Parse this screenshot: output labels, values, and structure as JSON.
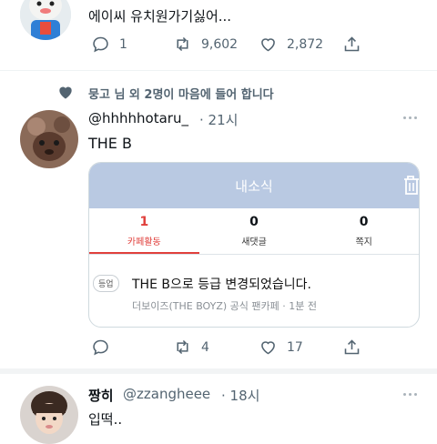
{
  "tweet1": {
    "text": "에이씨 유치원가기싫어...",
    "actions": {
      "replies": "1",
      "retweets": "9,602",
      "likes": "2,872"
    }
  },
  "social_context": "뭉고 님 외 2명이 마음에 들어 합니다",
  "tweet2": {
    "handle": "@hhhhhotaru_",
    "time": "· 21시",
    "text": "THE B",
    "card": {
      "header": "내소식",
      "stats": [
        {
          "num": "1",
          "label": "카페활동"
        },
        {
          "num": "0",
          "label": "새댓글"
        },
        {
          "num": "0",
          "label": "쪽지"
        }
      ],
      "badge": "등업",
      "message": "THE B으로 등급 변경되었습니다.",
      "source": "더보이즈(THE BOYZ) 공식 팬카페 · 1분 전"
    },
    "actions": {
      "retweets": "4",
      "likes": "17"
    }
  },
  "tweet3": {
    "name": "짱히",
    "handle": "@zzangheee",
    "time": "· 18시",
    "text": "입떡.."
  },
  "colors": {
    "accent": "#e0403c",
    "card_header": "#b9c9e2",
    "muted": "#536471"
  }
}
